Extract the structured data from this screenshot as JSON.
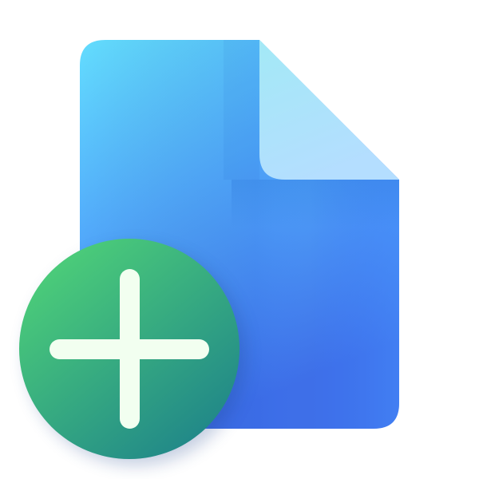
{
  "icon": {
    "name": "new-document-icon",
    "document": {
      "icon_name": "file-icon",
      "colors": {
        "top": "#63DDFE",
        "mid": "#52AAFB",
        "bottom": "#3E6FE8",
        "bottom_right": "#4793FF"
      },
      "fold_colors": {
        "top": "#A3E9F6",
        "bottom": "#B4DEFF"
      }
    },
    "badge": {
      "icon_name": "plus-icon",
      "colors": {
        "top_left": "#4CCD79",
        "bottom_right": "#1F8589"
      },
      "glyph_color": "#F2FFF0"
    }
  }
}
